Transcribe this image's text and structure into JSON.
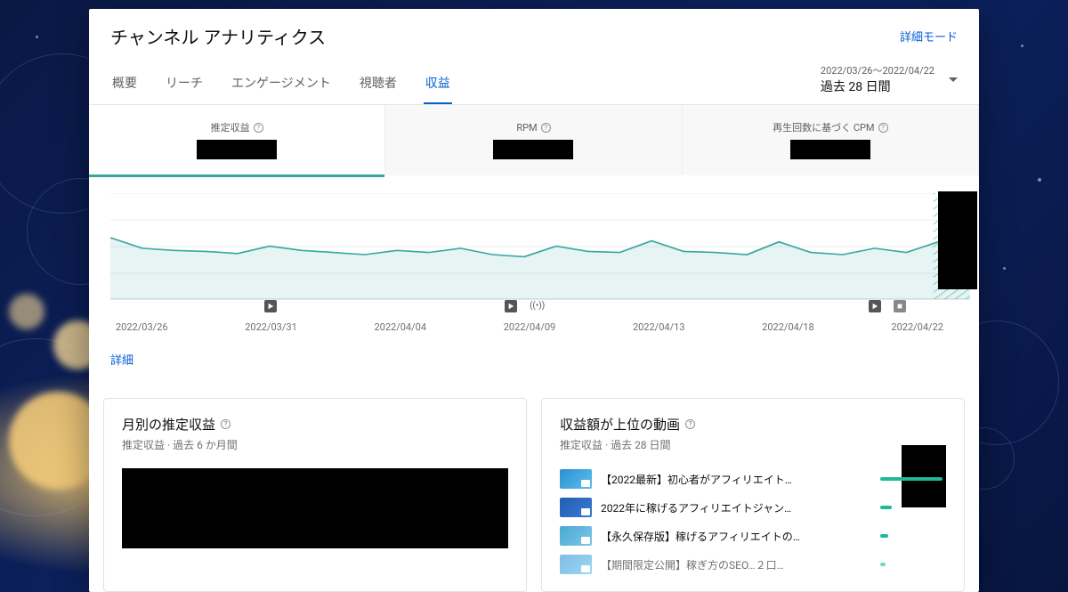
{
  "header": {
    "title": "チャンネル アナリティクス",
    "advanced": "詳細モード"
  },
  "tabs": {
    "items": [
      "概要",
      "リーチ",
      "エンゲージメント",
      "視聴者",
      "収益"
    ],
    "active_index": 4
  },
  "date_picker": {
    "range": "2022/03/26～2022/04/22",
    "label": "過去 28 日間"
  },
  "metrics": [
    {
      "label": "推定収益"
    },
    {
      "label": "RPM"
    },
    {
      "label": "再生回数に基づく CPM"
    }
  ],
  "detail_link": "詳細",
  "chart_data": {
    "type": "line",
    "title": "",
    "xlabel": "",
    "ylabel": "",
    "ylim": [
      0,
      100
    ],
    "x_ticks": [
      "2022/03/26",
      "2022/03/31",
      "2022/04/04",
      "2022/04/09",
      "2022/04/13",
      "2022/04/18",
      "2022/04/22"
    ],
    "series": [
      {
        "name": "推定収益",
        "values": [
          58,
          48,
          46,
          45,
          43,
          50,
          46,
          44,
          42,
          46,
          44,
          48,
          42,
          40,
          50,
          45,
          44,
          55,
          45,
          44,
          42,
          54,
          44,
          42,
          48,
          44,
          54,
          58
        ]
      }
    ],
    "event_markers": [
      {
        "x_index": 5,
        "type": "video"
      },
      {
        "x_index": 13,
        "type": "video"
      },
      {
        "x_index": 14,
        "type": "live"
      },
      {
        "x_index": 25,
        "type": "video"
      },
      {
        "x_index": 26,
        "type": "short"
      }
    ]
  },
  "monthly_card": {
    "title": "月別の推定収益",
    "subtitle": "推定収益 · 過去 6 か月間"
  },
  "top_videos_card": {
    "title": "収益額が上位の動画",
    "subtitle": "推定収益 · 過去 28 日間",
    "items": [
      {
        "title": "【2022最新】初心者がアフィリエイト…",
        "bar_pct": 95
      },
      {
        "title": "2022年に稼げるアフィリエイトジャン…",
        "bar_pct": 18
      },
      {
        "title": "【永久保存版】稼げるアフィリエイトの…",
        "bar_pct": 12
      },
      {
        "title": "【期間限定公開】稼ぎ方のSEO…２口…",
        "bar_pct": 8
      }
    ]
  }
}
